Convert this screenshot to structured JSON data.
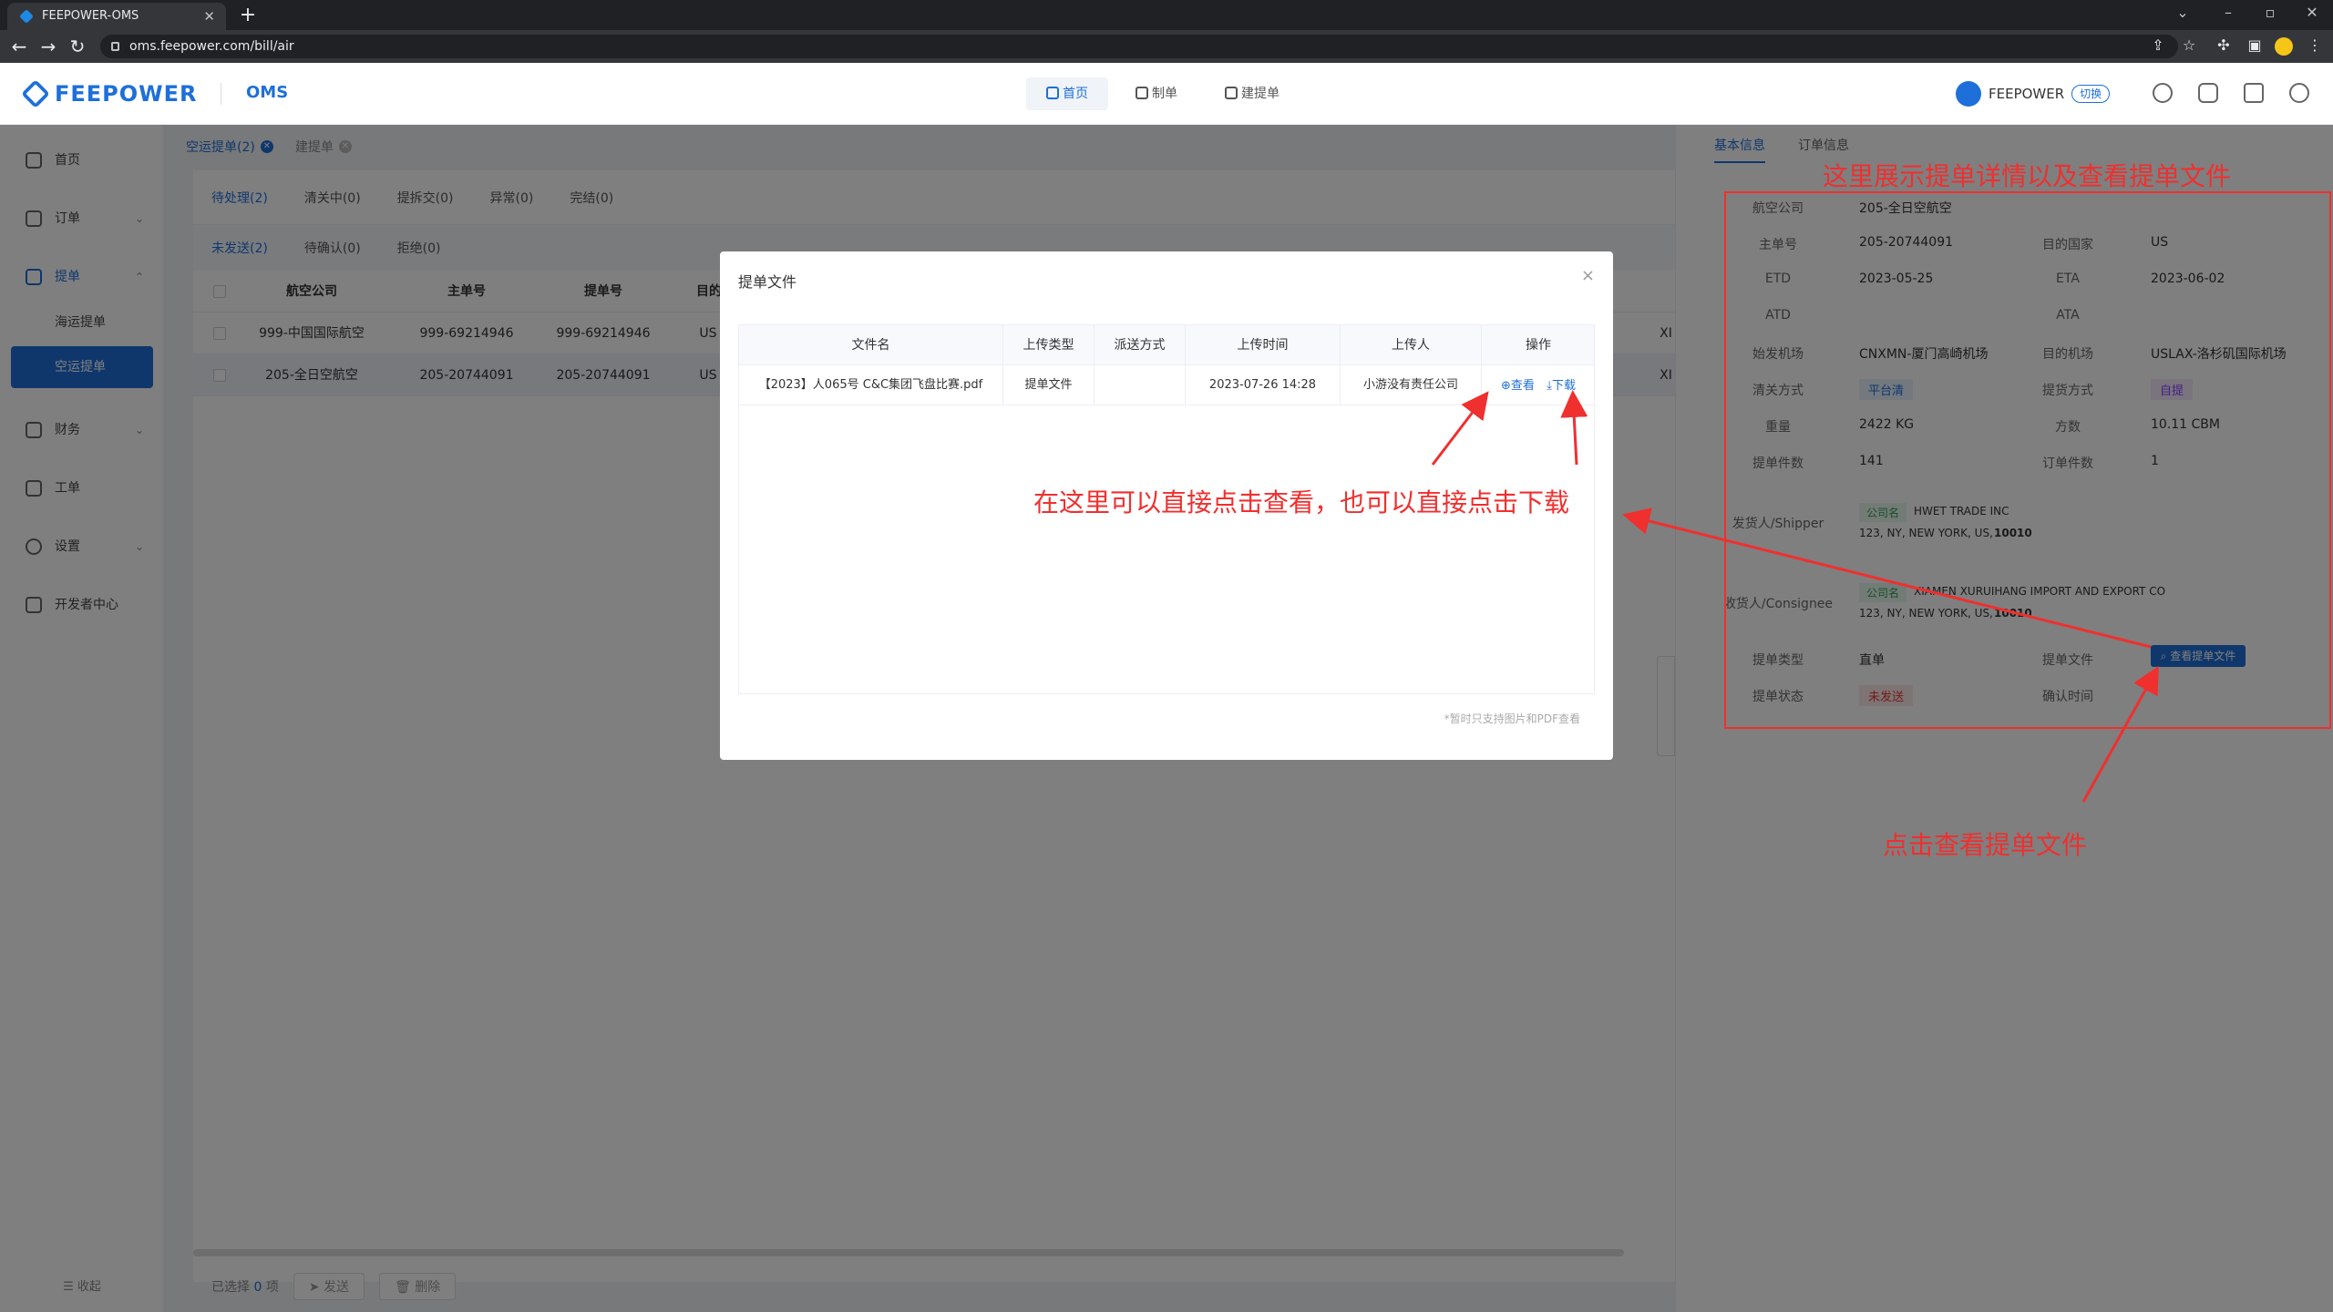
{
  "browser": {
    "tab_title": "FEEPOWER-OMS",
    "tab_close": "✕",
    "new_tab": "+",
    "url": "oms.feepower.com/bill/air",
    "nav_back": "←",
    "nav_forward": "→",
    "nav_reload": "↻"
  },
  "header": {
    "logo": "FEEPOWER",
    "product": "OMS",
    "nav": [
      {
        "label": "首页"
      },
      {
        "label": "制单"
      },
      {
        "label": "建提单"
      }
    ],
    "user": "FEEPOWER",
    "switch": "切换"
  },
  "sidebar": {
    "items": [
      {
        "label": "首页"
      },
      {
        "label": "订单"
      },
      {
        "label": "提单"
      },
      {
        "label": "财务"
      },
      {
        "label": "工单"
      },
      {
        "label": "设置"
      },
      {
        "label": "开发者中心"
      }
    ],
    "sub_items": [
      {
        "label": "海运提单"
      },
      {
        "label": "空运提单"
      }
    ],
    "collapse": "收起"
  },
  "page_tabs": [
    {
      "label": "空运提单(2)"
    },
    {
      "label": "建提单"
    }
  ],
  "status_tabs": [
    "待处理(2)",
    "清关中(0)",
    "提拆交(0)",
    "异常(0)",
    "完结(0)"
  ],
  "sub_tabs": [
    "未发送(2)",
    "待确认(0)",
    "拒绝(0)"
  ],
  "table": {
    "headers": [
      "航空公司",
      "主单号",
      "提单号",
      "目的国家"
    ],
    "rows": [
      {
        "airline": "999-中国国际航空",
        "master": "999-69214946",
        "bill": "999-69214946",
        "country": "US",
        "extra": "XI"
      },
      {
        "airline": "205-全日空航空",
        "master": "205-20744091",
        "bill": "205-20744091",
        "country": "US",
        "extra": "XI"
      }
    ]
  },
  "footer": {
    "selected_prefix": "已选择",
    "selected_count": "0",
    "selected_suffix": "项",
    "send": "发送",
    "delete": "删除"
  },
  "detail": {
    "tabs": [
      "基本信息",
      "订单信息"
    ],
    "fields": {
      "airline_label": "航空公司",
      "airline": "205-全日空航空",
      "master_label": "主单号",
      "master": "205-20744091",
      "dest_label": "目的国家",
      "dest": "US",
      "etd_label": "ETD",
      "etd": "2023-05-25",
      "eta_label": "ETA",
      "eta": "2023-06-02",
      "atd_label": "ATD",
      "ata_label": "ATA",
      "origin_label": "始发机场",
      "origin": "CNXMN-厦门高崎机场",
      "dest_airport_label": "目的机场",
      "dest_airport": "USLAX-洛杉矶国际机场",
      "clearance_label": "清关方式",
      "clearance": "平台清",
      "pickup_label": "提货方式",
      "pickup": "自提",
      "weight_label": "重量",
      "weight": "2422 KG",
      "volume_label": "方数",
      "volume": "10.11 CBM",
      "pieces_label": "提单件数",
      "pieces": "141",
      "order_count_label": "订单件数",
      "order_count": "1",
      "shipper_label": "发货人/Shipper",
      "company_tag": "公司名",
      "shipper_name": "HWET TRADE INC",
      "shipper_addr": "123,  NY, NEW YORK, US,",
      "shipper_zip": "10010",
      "consignee_label": "收货人/Consignee",
      "consignee_name": "XIAMEN XURUIHANG IMPORT AND EXPORT CO",
      "consignee_addr": "123,  NY, NEW YORK, US,",
      "consignee_zip": "10010",
      "bill_type_label": "提单类型",
      "bill_type": "直单",
      "bill_file_label": "提单文件",
      "view_bill_btn": "查看提单文件",
      "bill_status_label": "提单状态",
      "bill_status": "未发送",
      "confirm_time_label": "确认时间"
    },
    "handle": "展开"
  },
  "modal": {
    "title": "提单文件",
    "close": "×",
    "headers": [
      "文件名",
      "上传类型",
      "派送方式",
      "上传时间",
      "上传人",
      "操作"
    ],
    "rows": [
      {
        "name": "【2023】人065号 C&C集团飞盘比赛.pdf",
        "type": "提单文件",
        "delivery": "",
        "time": "2023-07-26 14:28",
        "uploader": "小游没有责任公司",
        "view": "查看",
        "download": "下载"
      }
    ],
    "note": "*暂时只支持图片和PDF查看"
  },
  "annotations": {
    "top_right": "这里展示提单详情以及查看提单文件",
    "middle": "在这里可以直接点击查看，也可以直接点击下载",
    "bottom": "点击查看提单文件",
    "color": "#f02f2f"
  },
  "colors": {
    "primary": "#1e6fd9",
    "overlay": "rgba(0,0,0,0.5)"
  }
}
